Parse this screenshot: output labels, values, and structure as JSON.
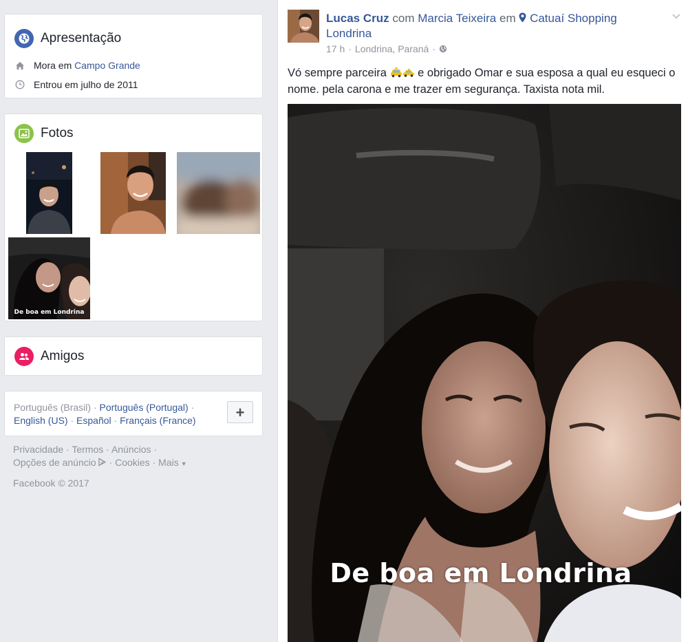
{
  "intro": {
    "title": "Apresentação",
    "lives_prefix": "Mora em",
    "lives_city": "Campo Grande",
    "joined": "Entrou em julho de 2011"
  },
  "photos": {
    "title": "Fotos",
    "caption_thumb": "De boa em Londrina"
  },
  "friends": {
    "title": "Amigos"
  },
  "languages": {
    "current": "Português (Brasil)",
    "items": [
      "Português (Portugal)",
      "English (US)",
      "Español",
      "Français (France)"
    ],
    "add_label": "+"
  },
  "footer": {
    "links": [
      "Privacidade",
      "Termos",
      "Anúncios",
      "Opções de anúncio",
      "Cookies",
      "Mais"
    ],
    "copyright": "Facebook © 2017"
  },
  "post": {
    "author": "Lucas Cruz",
    "with_word": "com",
    "tagged": "Marcia Teixeira",
    "at_word": "em",
    "place": "Catuaí Shopping Londrina",
    "time": "17 h",
    "location": "Londrina, Paraná",
    "text_part1": "Vó sempre parceira",
    "text_part2": "e obrigado Omar e sua esposa a qual eu esqueci o nome. pela carona e me trazer em segurança. Taxista nota mil.",
    "photo_caption": "De boa em Londrina"
  },
  "colors": {
    "link": "#365899",
    "intro_icon": "#4267b2",
    "photos_icon": "#8bc34a",
    "friends_icon": "#e91e63",
    "page_bg": "#e9ebee"
  },
  "icons": {
    "intro": "globe-icon",
    "photos": "photo-icon",
    "friends": "people-icon",
    "home": "home-icon",
    "clock": "clock-icon",
    "place": "location-pin-icon",
    "privacy": "globe-icon",
    "chevron": "chevron-down-icon"
  }
}
